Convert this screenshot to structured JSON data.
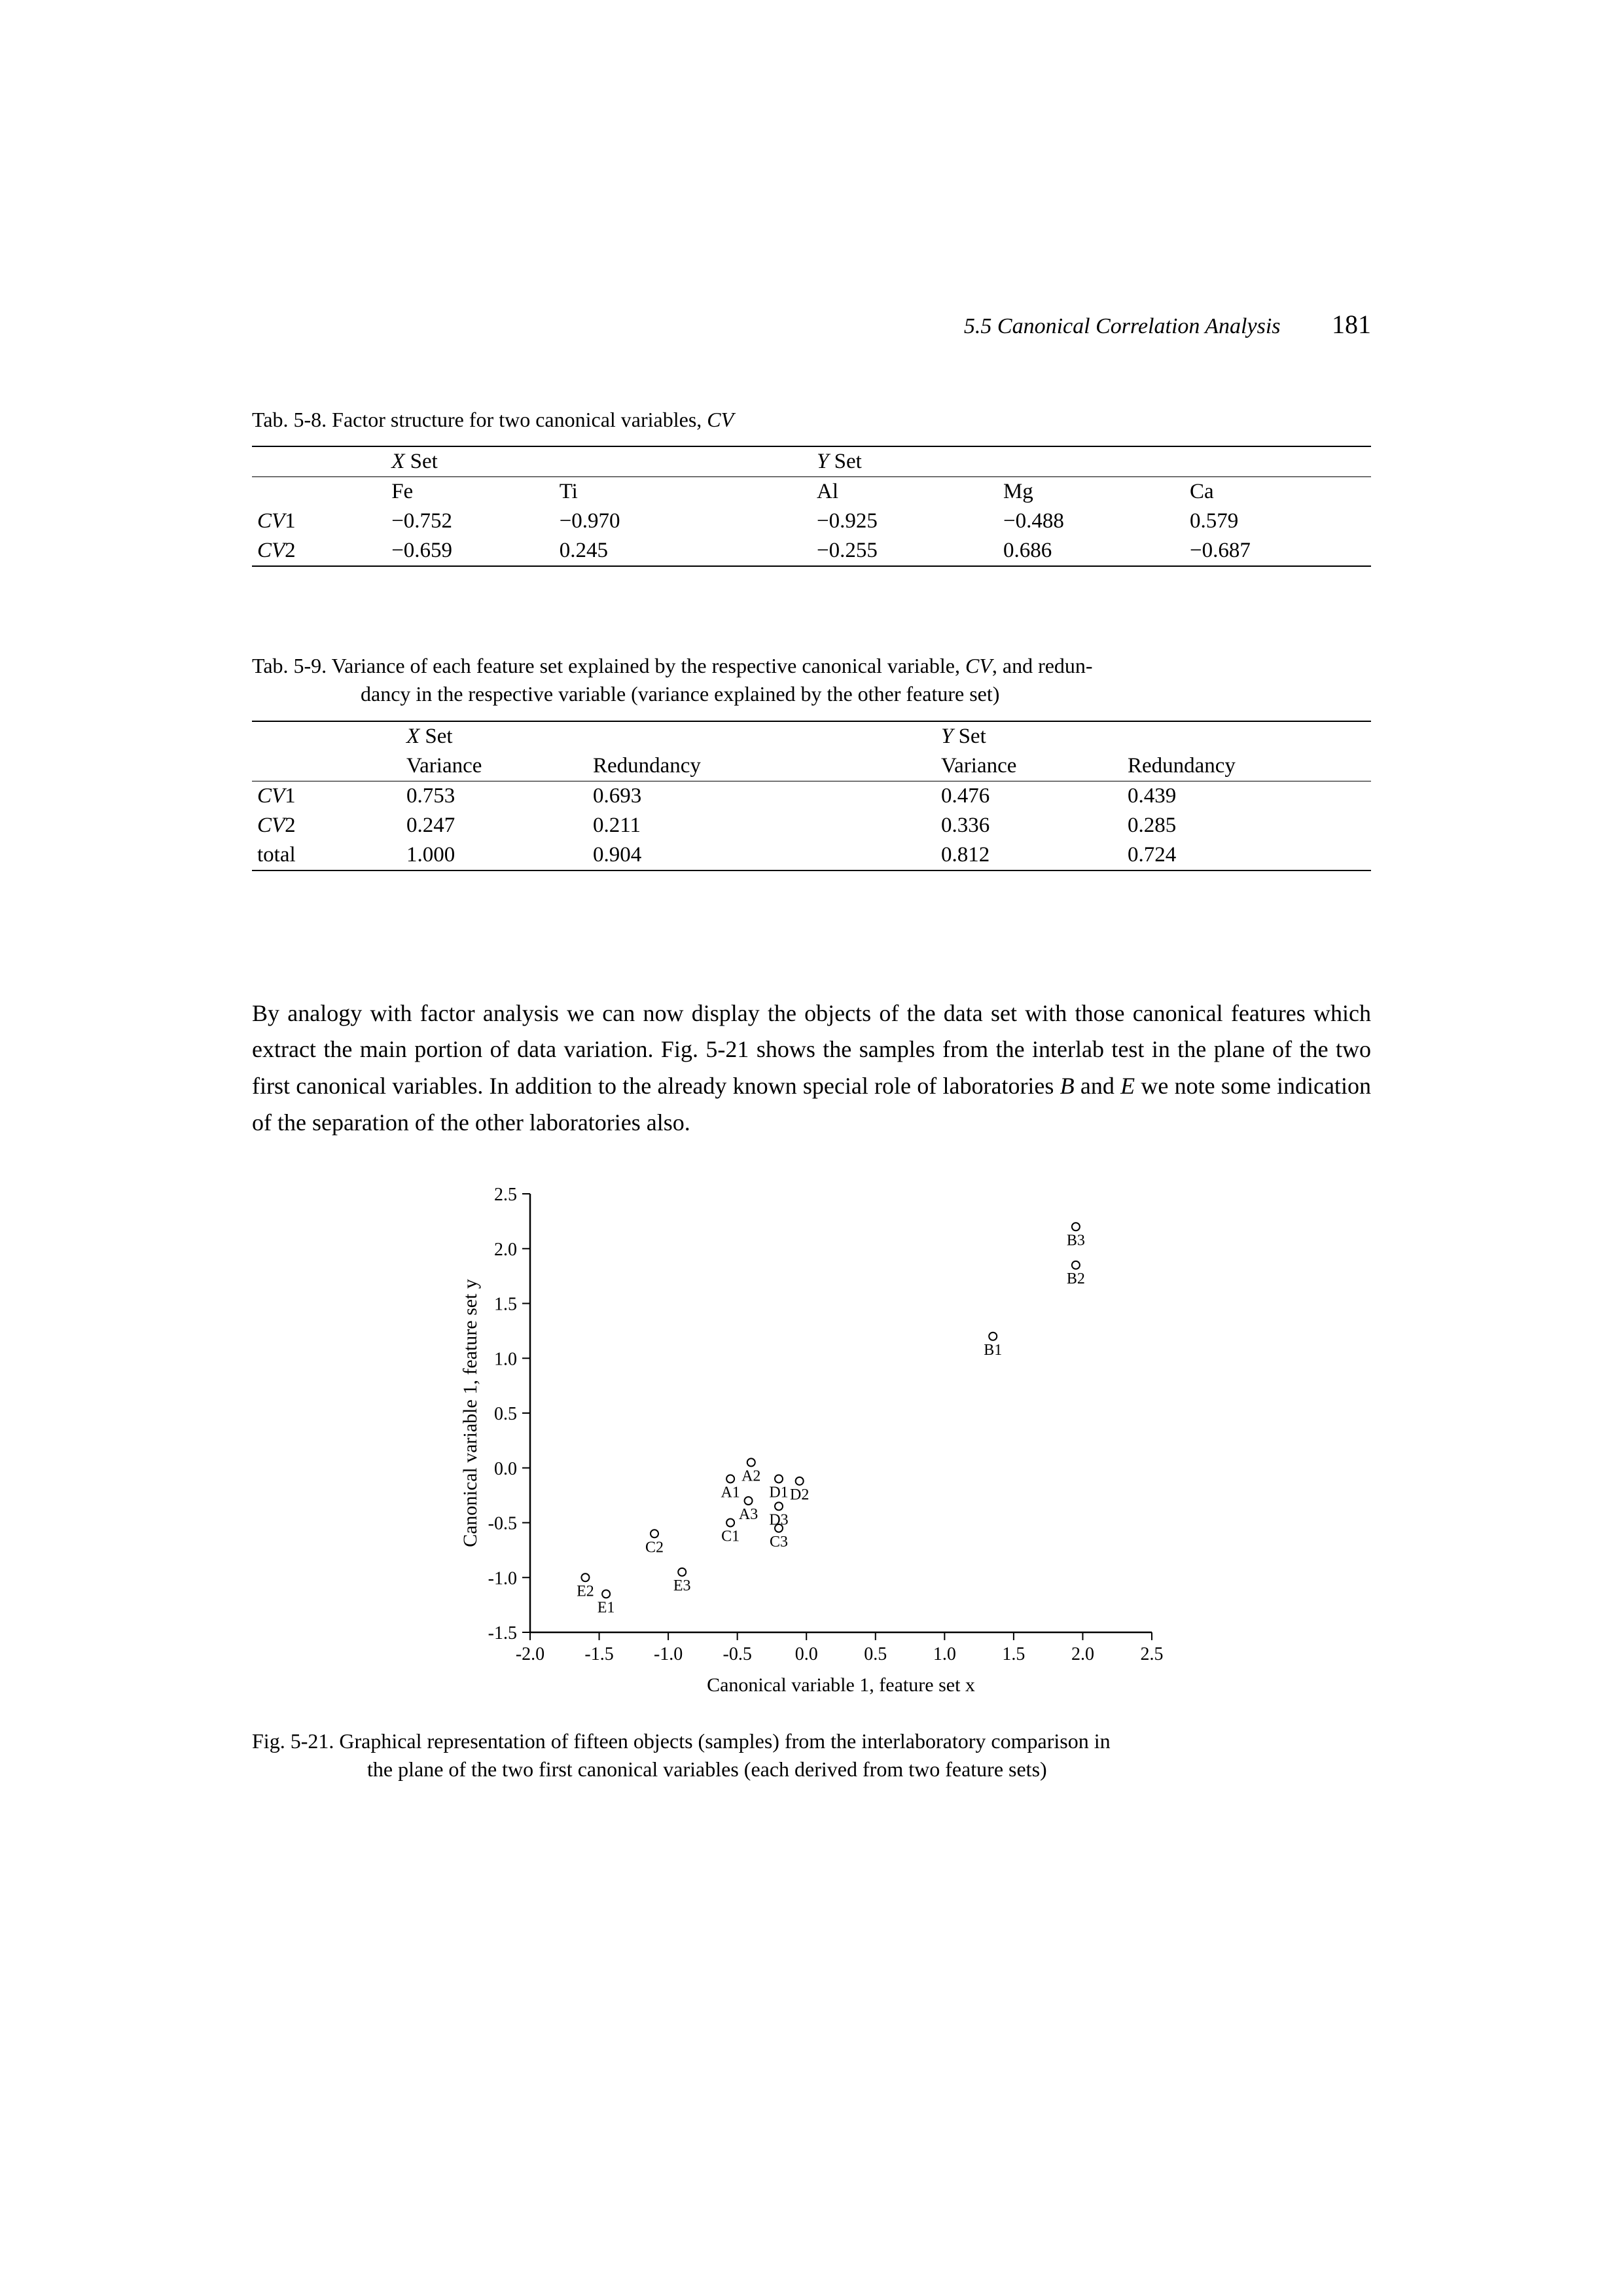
{
  "header": {
    "section": "5.5  Canonical Correlation Analysis",
    "page_number": "181"
  },
  "table58": {
    "caption_prefix": "Tab. 5-8. ",
    "caption": "Factor structure for two canonical variables, ",
    "caption_italic": "CV",
    "xset_label": "X",
    "xset_suffix": " Set",
    "yset_label": "Y",
    "yset_suffix": " Set",
    "col_fe": "Fe",
    "col_ti": "Ti",
    "col_al": "Al",
    "col_mg": "Mg",
    "col_ca": "Ca",
    "row1_label": "CV",
    "row1_num": "1",
    "row2_label": "CV",
    "row2_num": "2",
    "r1_fe": "−0.752",
    "r1_ti": "−0.970",
    "r1_al": "−0.925",
    "r1_mg": "−0.488",
    "r1_ca": "0.579",
    "r2_fe": "−0.659",
    "r2_ti": "0.245",
    "r2_al": "−0.255",
    "r2_mg": "0.686",
    "r2_ca": "−0.687"
  },
  "table59": {
    "caption_prefix": "Tab. 5-9. ",
    "caption_line1a": "Variance of each feature set explained by the respective canonical variable, ",
    "caption_line1_it": "CV",
    "caption_line1b": ", and redun-",
    "caption_line2": "dancy in the respective variable (variance explained by the other feature set)",
    "xset_label": "X",
    "xset_suffix": " Set",
    "yset_label": "Y",
    "yset_suffix": " Set",
    "col_var": "Variance",
    "col_red": "Redundancy",
    "row1_label": "CV",
    "row1_num": "1",
    "row2_label": "CV",
    "row2_num": "2",
    "row3_label": "total",
    "r1_xv": "0.753",
    "r1_xr": "0.693",
    "r1_yv": "0.476",
    "r1_yr": "0.439",
    "r2_xv": "0.247",
    "r2_xr": "0.211",
    "r2_yv": "0.336",
    "r2_yr": "0.285",
    "r3_xv": "1.000",
    "r3_xr": "0.904",
    "r3_yv": "0.812",
    "r3_yr": "0.724"
  },
  "paragraph": {
    "t1": "By analogy with factor analysis we can now display the objects of the data set with those canonical features which extract the main portion of data variation. Fig. 5-21 shows the samples from the interlab test in the plane of the two first canonical variables. In addition to the already known special role of laboratories ",
    "it1": "B",
    "t2": " and ",
    "it2": "E",
    "t3": " we note some indication of the separation of the other laboratories also."
  },
  "figure": {
    "caption_prefix": "Fig. 5-21. ",
    "caption_line1": "Graphical representation of fifteen objects (samples) from the interlaboratory comparison in",
    "caption_line2": "the plane of the two first canonical variables (each derived from two feature sets)",
    "xlabel": "Canonical variable 1, feature set  x",
    "ylabel": "Canonical variable 1, feature set y"
  },
  "chart_data": {
    "type": "scatter",
    "title": "",
    "xlabel": "Canonical variable 1, feature set x",
    "ylabel": "Canonical variable 1, feature set y",
    "xlim": [
      -2.0,
      2.5
    ],
    "ylim": [
      -1.5,
      2.5
    ],
    "xticks": [
      -2.0,
      -1.5,
      -1.0,
      -0.5,
      0.0,
      0.5,
      1.0,
      1.5,
      2.0,
      2.5
    ],
    "yticks": [
      -1.5,
      -1.0,
      -0.5,
      0.0,
      0.5,
      1.0,
      1.5,
      2.0,
      2.5
    ],
    "points": [
      {
        "label": "A1",
        "x": -0.55,
        "y": -0.1
      },
      {
        "label": "A2",
        "x": -0.4,
        "y": 0.05
      },
      {
        "label": "A3",
        "x": -0.42,
        "y": -0.3
      },
      {
        "label": "B1",
        "x": 1.35,
        "y": 1.2
      },
      {
        "label": "B2",
        "x": 1.95,
        "y": 1.85
      },
      {
        "label": "B3",
        "x": 1.95,
        "y": 2.2
      },
      {
        "label": "C1",
        "x": -0.55,
        "y": -0.5
      },
      {
        "label": "C2",
        "x": -1.1,
        "y": -0.6
      },
      {
        "label": "C3",
        "x": -0.2,
        "y": -0.55
      },
      {
        "label": "D1",
        "x": -0.2,
        "y": -0.1
      },
      {
        "label": "D2",
        "x": -0.05,
        "y": -0.12
      },
      {
        "label": "D3",
        "x": -0.2,
        "y": -0.35
      },
      {
        "label": "E1",
        "x": -1.45,
        "y": -1.15
      },
      {
        "label": "E2",
        "x": -1.6,
        "y": -1.0
      },
      {
        "label": "E3",
        "x": -0.9,
        "y": -0.95
      }
    ]
  }
}
